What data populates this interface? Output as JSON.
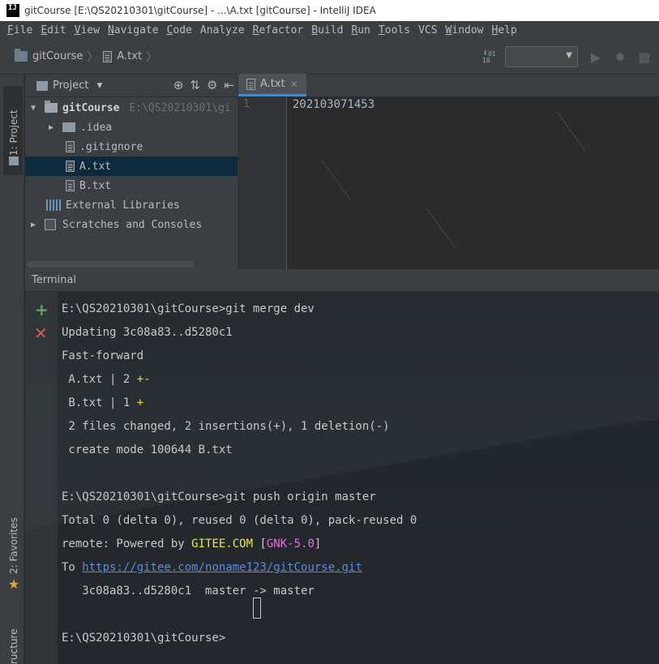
{
  "window": {
    "app_icon_text": "IJ",
    "title": "gitCourse [E:\\QS20210301\\gitCourse] - ...\\A.txt [gitCourse] - IntelliJ IDEA"
  },
  "menu": [
    {
      "mnemonic": "F",
      "rest": "ile"
    },
    {
      "mnemonic": "E",
      "rest": "dit"
    },
    {
      "mnemonic": "V",
      "rest": "iew"
    },
    {
      "mnemonic": "N",
      "rest": "avigate"
    },
    {
      "mnemonic": "C",
      "rest": "ode"
    },
    {
      "mnemonic": "",
      "rest": "Analyze"
    },
    {
      "mnemonic": "R",
      "rest": "efactor"
    },
    {
      "mnemonic": "B",
      "rest": "uild"
    },
    {
      "mnemonic": "R",
      "rest": "un"
    },
    {
      "mnemonic": "T",
      "rest": "ools"
    },
    {
      "mnemonic": "",
      "rest": "VCS"
    },
    {
      "mnemonic": "W",
      "rest": "indow"
    },
    {
      "mnemonic": "H",
      "rest": "elp"
    }
  ],
  "breadcrumb": {
    "project": "gitCourse",
    "file": "A.txt"
  },
  "navbar": {
    "vcs_icon": "vcs-update-icon",
    "run_config_value": "",
    "run_icon": "run-icon",
    "debug_icon": "debug-icon",
    "coverage_icon": "coverage-icon"
  },
  "stripe": {
    "project_label": "1: Project",
    "favorites_label": "2: Favorites",
    "structure_label": "ructure"
  },
  "project_panel": {
    "title": "Project",
    "tree": [
      {
        "label": "gitCourse",
        "hint": "E:\\QS20210301\\gi",
        "type": "root",
        "level": 0,
        "expanded": true
      },
      {
        "label": ".idea",
        "type": "folder",
        "level": 1,
        "expanded": false
      },
      {
        "label": ".gitignore",
        "type": "file",
        "level": 1
      },
      {
        "label": "A.txt",
        "type": "file",
        "level": 1,
        "selected": true
      },
      {
        "label": "B.txt",
        "type": "file",
        "level": 1
      },
      {
        "label": "External Libraries",
        "type": "library",
        "level": 0
      },
      {
        "label": "Scratches and Consoles",
        "type": "scratch",
        "level": 0,
        "expanded": false
      }
    ]
  },
  "editor": {
    "tab_label": "A.txt",
    "line_number": "1",
    "content": "202103071453"
  },
  "terminal": {
    "title": "Terminal",
    "lines": {
      "l1": "E:\\QS20210301\\gitCourse>git merge dev",
      "l2": "Updating 3c08a83..d5280c1",
      "l3": "Fast-forward",
      "l4a": " A.txt | 2 ",
      "l4b": "+",
      "l4c": "-",
      "l5a": " B.txt | 1 ",
      "l5b": "+",
      "l6": " 2 files changed, 2 insertions(+), 1 deletion(-)",
      "l7": " create mode 100644 B.txt",
      "l9": "E:\\QS20210301\\gitCourse>git push origin master",
      "l10": "Total 0 (delta 0), reused 0 (delta 0), pack-reused 0",
      "l11a": "remote: Powered by ",
      "l11b": "GITEE.COM",
      "l11c": " [",
      "l11d": "GNK-5.0",
      "l11e": "]",
      "l12a": "To ",
      "l12b": "https://gitee.com/noname123/gitCourse.git",
      "l13": "   3c08a83..d5280c1  master -> master",
      "l15": "E:\\QS20210301\\gitCourse>"
    }
  },
  "colors": {
    "background": "#2b2b2b",
    "panel": "#3c3f41",
    "selection": "#0d293e",
    "accent": "#4a88c7",
    "add_green": "#59a869",
    "close_red": "#e05555"
  }
}
